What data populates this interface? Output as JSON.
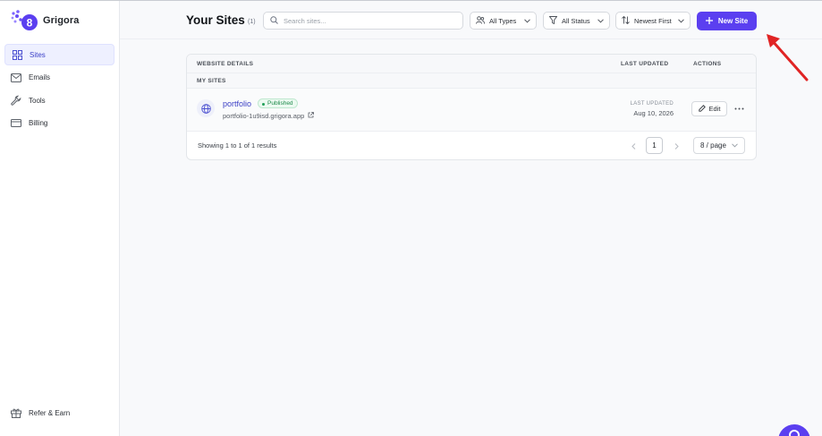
{
  "brand": {
    "name": "Grigora",
    "logo_icon": "grigora-logo-icon",
    "accent": "#5b3ff0"
  },
  "sidebar": {
    "items": [
      {
        "label": "Sites",
        "icon": "grid-icon",
        "active": true
      },
      {
        "label": "Emails",
        "icon": "mail-icon",
        "active": false
      },
      {
        "label": "Tools",
        "icon": "wrench-icon",
        "active": false
      },
      {
        "label": "Billing",
        "icon": "credit-card-icon",
        "active": false
      }
    ],
    "refer": {
      "label": "Refer & Earn",
      "icon": "gift-icon"
    }
  },
  "header": {
    "title": "Your Sites",
    "count": "(1)",
    "search": {
      "placeholder": "Search sites...",
      "value": ""
    },
    "filters": [
      {
        "label": "All Types",
        "icon": "users-icon"
      },
      {
        "label": "All Status",
        "icon": "filter-icon"
      },
      {
        "label": "Newest First",
        "icon": "sort-icon"
      }
    ],
    "new_site_label": "New Site"
  },
  "table": {
    "columns": {
      "details": "WEBSITE DETAILS",
      "updated": "LAST UPDATED",
      "actions": "ACTIONS"
    },
    "group_label": "MY SITES",
    "rows": [
      {
        "name": "portfolio",
        "status": "Published",
        "url": "portfolio-1u9isd.grigora.app",
        "last_updated_label": "LAST UPDATED",
        "last_updated": "Aug 10, 2026",
        "edit_label": "Edit"
      }
    ],
    "footer": {
      "showing": "Showing 1 to 1 of 1 results",
      "page": "1",
      "per_page": "8 / page"
    }
  },
  "colors": {
    "primary": "#5b3ff0",
    "published": "#1f8a4c",
    "annotation_arrow": "#e02424"
  }
}
